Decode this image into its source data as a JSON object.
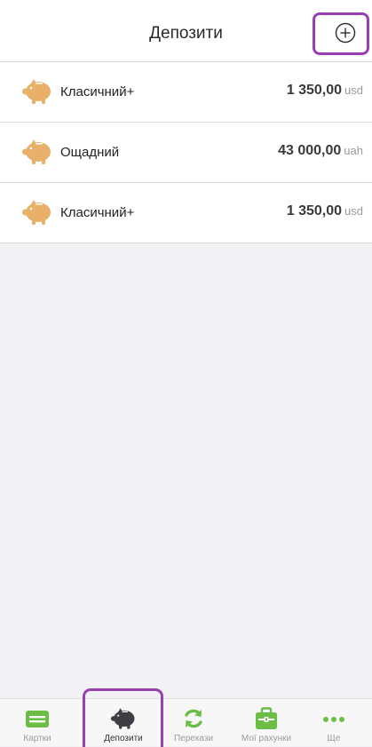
{
  "header": {
    "title": "Депозити",
    "add_icon": "plus-circle-icon"
  },
  "deposits": [
    {
      "name": "Класичний+",
      "amount": "1 350,00",
      "currency": "usd",
      "icon": "piggy-bank-icon"
    },
    {
      "name": "Ощадний",
      "amount": "43 000,00",
      "currency": "uah",
      "icon": "piggy-bank-icon"
    },
    {
      "name": "Класичний+",
      "amount": "1 350,00",
      "currency": "usd",
      "icon": "piggy-bank-icon"
    }
  ],
  "tabbar": {
    "active_tab": "Депозити",
    "tabs": [
      {
        "label": "Картки",
        "icon": "card-icon"
      },
      {
        "label": "Депозити",
        "icon": "piggy-bank-icon"
      },
      {
        "label": "Перекази",
        "icon": "transfer-arrows-icon"
      },
      {
        "label": "Мої рахунки",
        "icon": "briefcase-icon"
      },
      {
        "label": "Ще",
        "icon": "more-dots-icon"
      }
    ]
  },
  "colors": {
    "accent_green": "#6cbd45",
    "piggy_gold": "#e9b06a",
    "highlight_purple": "#9a3fb3",
    "active_tab_icon": "#3e3e44"
  }
}
